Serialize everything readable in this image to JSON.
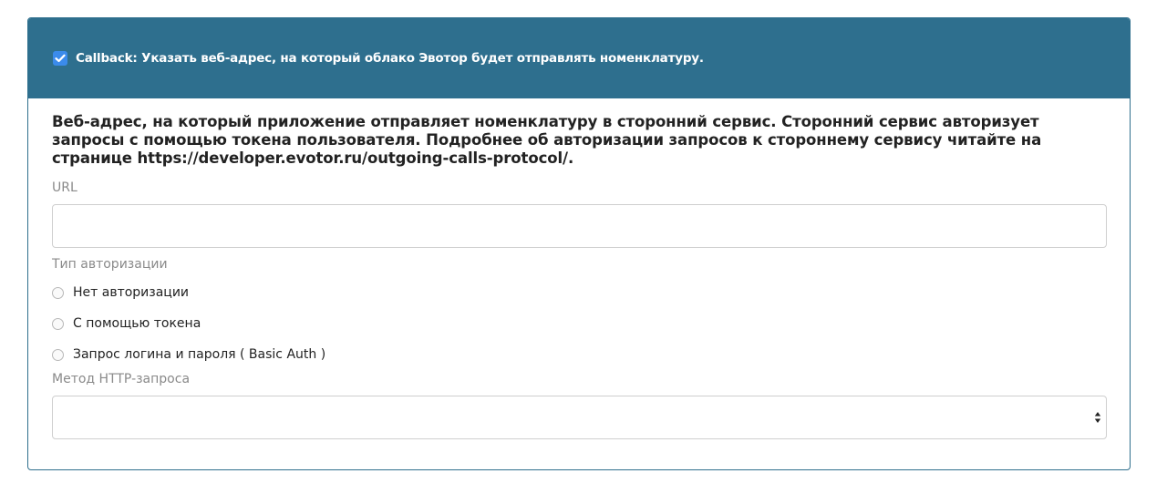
{
  "header": {
    "checkbox_checked": true,
    "checkbox_color": "#3b8beb",
    "background_color": "#2e6f8e",
    "label": "Callback: Указать веб-адрес, на который облако Эвотор будет отправлять номенклатуру."
  },
  "body": {
    "description": "Веб-адрес, на который приложение отправляет номенклатуру в сторонний сервис. Сторонний сервис авторизует запросы с помощью токена пользователя. Подробнее об авторизации запросов к стороннему сервису читайте на странице https://developer.evotor.ru/outgoing-calls-protocol/.",
    "url_field": {
      "label": "URL",
      "value": "",
      "placeholder": ""
    },
    "auth": {
      "label": "Тип авторизации",
      "options": [
        {
          "label": "Нет авторизации",
          "selected": false
        },
        {
          "label": "С помощью токена",
          "selected": false
        },
        {
          "label": "Запрос логина и пароля ( Basic Auth )",
          "selected": false
        }
      ]
    },
    "method": {
      "label": "Метод HTTP-запроса",
      "selected_value": "",
      "icon": "select-arrows-icon"
    }
  }
}
